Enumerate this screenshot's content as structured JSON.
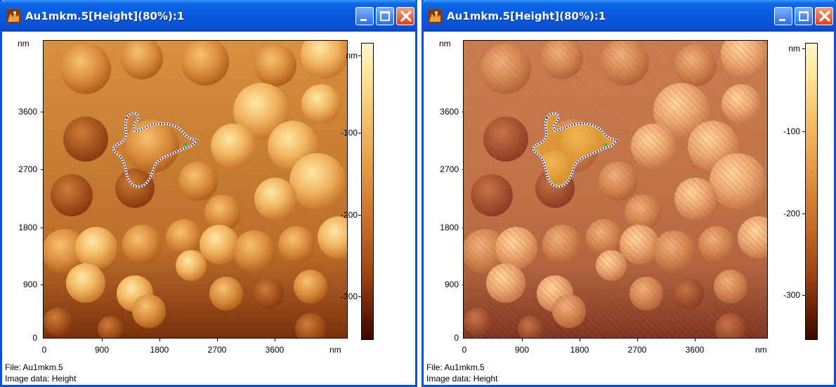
{
  "windows": [
    {
      "title": "Au1mkm.5[Height](80%):1",
      "y_unit": "nm",
      "y_ticks": [
        "3600",
        "2700",
        "1800",
        "900",
        "0"
      ],
      "x_ticks": [
        "0",
        "900",
        "1800",
        "2700",
        "3600"
      ],
      "x_unit": "nm",
      "colorbar_unit": "nm",
      "colorbar_ticks": [
        "-100",
        "-200",
        "-300"
      ],
      "file_label": "File: Au1mkm.5",
      "image_data_label": "Image data: Height",
      "hatched": false
    },
    {
      "title": "Au1mkm.5[Height](80%):1",
      "y_unit": "nm",
      "y_ticks": [
        "3600",
        "2700",
        "1800",
        "900",
        "0"
      ],
      "x_ticks": [
        "0",
        "900",
        "1800",
        "2700",
        "3600"
      ],
      "x_unit": "nm",
      "colorbar_unit": "nm",
      "colorbar_ticks": [
        "-100",
        "-200",
        "-300"
      ],
      "file_label": "File: Au1mkm.5",
      "image_data_label": "Image data: Height",
      "hatched": true
    }
  ],
  "icons": {
    "app": "spm-app-icon",
    "minimize": "minimize-icon",
    "maximize": "maximize-icon",
    "close": "close-icon"
  },
  "colors": {
    "titlebar": "#0758da",
    "close_button": "#d9421c",
    "selection_outline": "#1a1a6e",
    "hatch": "#c05a3a"
  }
}
